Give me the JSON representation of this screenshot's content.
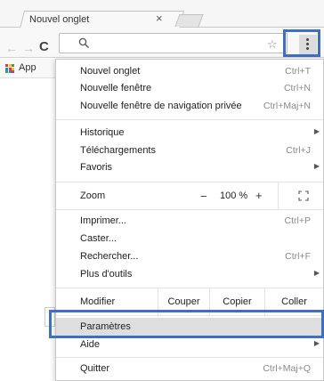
{
  "tab": {
    "title": "Nouvel onglet",
    "close": "×"
  },
  "toolbar": {
    "back": "←",
    "forward": "→",
    "reload": "C",
    "star": "☆"
  },
  "bookmarks": {
    "apps_label": "App"
  },
  "menu": {
    "new_tab": {
      "label": "Nouvel onglet",
      "shortcut": "Ctrl+T"
    },
    "new_window": {
      "label": "Nouvelle fenêtre",
      "shortcut": "Ctrl+N"
    },
    "incognito": {
      "label": "Nouvelle fenêtre de navigation privée",
      "shortcut": "Ctrl+Maj+N"
    },
    "history": {
      "label": "Historique"
    },
    "downloads": {
      "label": "Téléchargements",
      "shortcut": "Ctrl+J"
    },
    "bookmarks": {
      "label": "Favoris"
    },
    "zoom": {
      "label": "Zoom",
      "minus": "−",
      "value": "100 %",
      "plus": "+"
    },
    "print": {
      "label": "Imprimer...",
      "shortcut": "Ctrl+P"
    },
    "cast": {
      "label": "Caster..."
    },
    "find": {
      "label": "Rechercher...",
      "shortcut": "Ctrl+F"
    },
    "more_tools": {
      "label": "Plus d'outils"
    },
    "edit": {
      "label": "Modifier",
      "cut": "Couper",
      "copy": "Copier",
      "paste": "Coller"
    },
    "settings": {
      "label": "Paramètres"
    },
    "help": {
      "label": "Aide"
    },
    "quit": {
      "label": "Quitter",
      "shortcut": "Ctrl+Maj+Q"
    },
    "submenu_arrow": "▶"
  },
  "colors": {
    "highlight_border": "#3f6fc3",
    "hover_bg": "#dedede"
  }
}
